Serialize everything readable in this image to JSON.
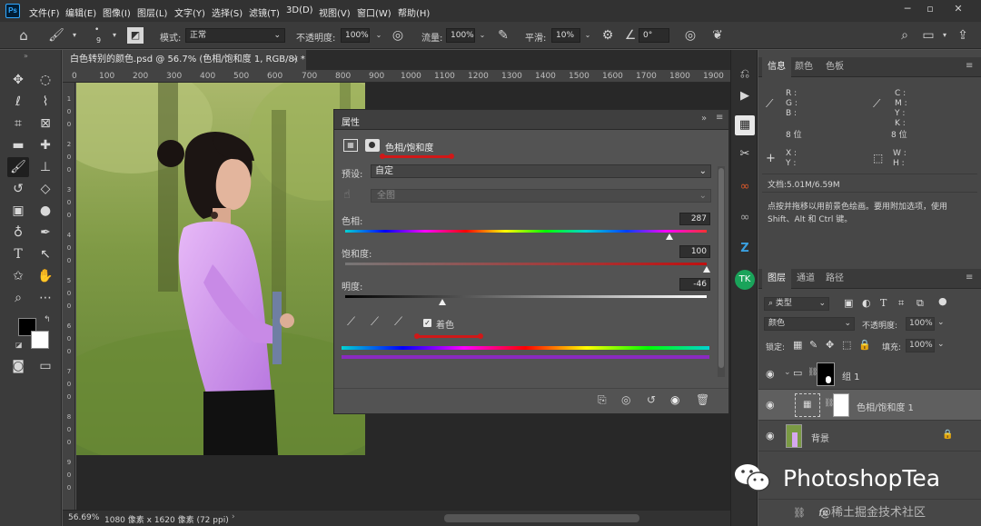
{
  "app": {
    "logo": "Ps"
  },
  "menu": [
    "文件(F)",
    "编辑(E)",
    "图像(I)",
    "图层(L)",
    "文字(Y)",
    "选择(S)",
    "滤镜(T)",
    "3D(D)",
    "视图(V)",
    "窗口(W)",
    "帮助(H)"
  ],
  "options": {
    "brush_size": "9",
    "mode_label": "模式:",
    "mode_value": "正常",
    "opacity_label": "不透明度:",
    "opacity_value": "100%",
    "flow_label": "流量:",
    "flow_value": "100%",
    "smooth_label": "平滑:",
    "smooth_value": "10%",
    "angle_value": "0°"
  },
  "document": {
    "tab_title": "白色转别的颜色.psd @ 56.7% (色相/饱和度 1, RGB/8) *",
    "ruler_ticks": [
      "0",
      "100",
      "200",
      "300",
      "400",
      "500",
      "600",
      "700",
      "800",
      "900",
      "1000",
      "1100",
      "1200",
      "1300",
      "1400",
      "1500",
      "1600",
      "1700",
      "1800",
      "1900",
      "2000"
    ],
    "ruler_left_ticks": [
      "1",
      "0",
      "0",
      "2",
      "0",
      "0",
      "3",
      "0",
      "0",
      "4",
      "0",
      "0",
      "5",
      "0",
      "0",
      "6",
      "0",
      "0",
      "7",
      "0",
      "0",
      "8",
      "0",
      "0",
      "9",
      "0",
      "0"
    ],
    "status_zoom": "56.69%",
    "status_info": "1080 像素 x 1620 像素 (72 ppi)"
  },
  "properties": {
    "title": "属性",
    "adjustment_name": "色相/饱和度",
    "preset_label": "预设:",
    "preset_value": "自定",
    "channel_value": "全图",
    "hue_label": "色相:",
    "hue_value": "287",
    "saturation_label": "饱和度:",
    "saturation_value": "100",
    "lightness_label": "明度:",
    "lightness_value": "-46",
    "colorize_label": "着色",
    "hue_fraction": 0.897,
    "saturation_fraction": 1.0,
    "lightness_fraction": 0.27
  },
  "info_panel": {
    "tabs": [
      "信息",
      "颜色",
      "色板"
    ],
    "rgb": [
      "R :",
      "G :",
      "B :"
    ],
    "cmyk": [
      "C :",
      "M :",
      "Y :",
      "K :"
    ],
    "bit1": "8 位",
    "bit2": "8 位",
    "xy": [
      "X :",
      "Y :"
    ],
    "wh": [
      "W :",
      "H :"
    ],
    "doc_size": "文档:5.01M/6.59M",
    "hint": "点按并拖移以用前景色绘画。要用附加选项，使用 Shift、Alt 和 Ctrl 键。"
  },
  "layers_panel": {
    "tabs": [
      "图层",
      "通道",
      "路径"
    ],
    "filter_kind": "类型",
    "blend_mode": "颜色",
    "opacity_label": "不透明度:",
    "opacity_value": "100%",
    "lock_label": "锁定:",
    "fill_label": "填充:",
    "fill_value": "100%",
    "layers": [
      {
        "name": "组 1"
      },
      {
        "name": "色相/饱和度 1"
      },
      {
        "name": "背景"
      }
    ]
  },
  "watermark": {
    "brand": "PhotoshopTea",
    "site": "@稀土掘金技术社区"
  },
  "colors": {
    "accent_red": "#d01818",
    "panel": "#535353",
    "dark": "#323232"
  }
}
